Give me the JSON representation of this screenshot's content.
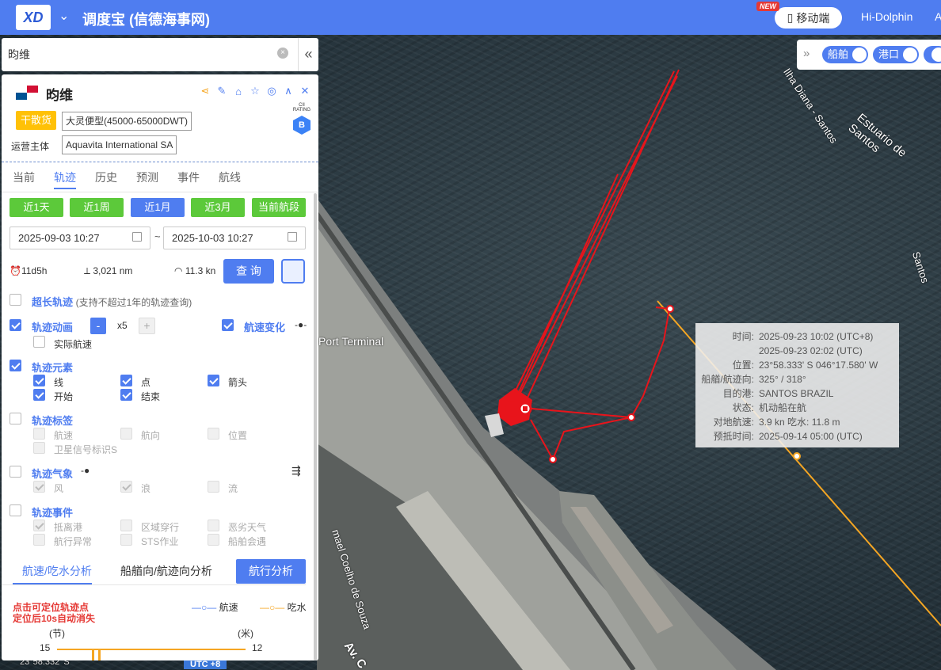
{
  "header": {
    "logo_text": "XD",
    "title": "调度宝 (信德海事网)",
    "new_badge": "NEW",
    "mobile_label": "移动端",
    "hi_dolphin": "Hi-Dolphin",
    "cut_text": "A"
  },
  "search": {
    "value": "昀维"
  },
  "ship": {
    "name": "昀维",
    "type_tag": "干散货",
    "size_tag": "大灵便型(45000-65000DWT)",
    "operator_label": "运营主体",
    "operator": "Aquavita International SA",
    "cii_label": "CII RATING",
    "cii": "B"
  },
  "tabs": [
    "当前",
    "轨迹",
    "历史",
    "预测",
    "事件",
    "航线"
  ],
  "range_buttons": [
    "近1天",
    "近1周",
    "近1月",
    "近3月",
    "当前航段"
  ],
  "dates": {
    "start": "2025-09-03 10:27",
    "end": "2025-10-03 10:27",
    "sep": "~"
  },
  "stats": {
    "duration": "11d5h",
    "distance": "3,021 nm",
    "speed": "11.3 kn"
  },
  "query_label": "查 询",
  "long_track": {
    "label": "超长轨迹",
    "note": "(支持不超过1年的轨迹查询)"
  },
  "animation": {
    "label": "轨迹动画",
    "minus": "-",
    "speed": "x5",
    "plus": "+",
    "actual_speed": "实际航速",
    "speed_change": "航速变化"
  },
  "elements": {
    "label": "轨迹元素",
    "items": [
      "线",
      "点",
      "箭头",
      "开始",
      "结束"
    ]
  },
  "labels": {
    "label": "轨迹标签",
    "items": [
      "航速",
      "航向",
      "位置",
      "卫星信号标识S"
    ]
  },
  "weather": {
    "label": "轨迹气象",
    "items": [
      "风",
      "浪",
      "流"
    ]
  },
  "events": {
    "label": "轨迹事件",
    "items": [
      "抵离港",
      "区域穿行",
      "恶劣天气",
      "航行异常",
      "STS作业",
      "船舶会遇"
    ]
  },
  "bottom_tabs": [
    "航速/吃水分析",
    "船艏向/航迹向分析",
    "航行分析"
  ],
  "chart_note": "点击可定位轨迹点\n定位后10s自动消失",
  "legend": {
    "speed": "航速",
    "draft": "吃水"
  },
  "axis": {
    "left_unit": "(节)",
    "right_unit": "(米)",
    "left_max": "15",
    "right_max": "12"
  },
  "tooltip": [
    {
      "k": "时间:",
      "v": "2025-09-23 10:02 (UTC+8)"
    },
    {
      "k": "",
      "v": "2025-09-23 02:02 (UTC)"
    },
    {
      "k": "位置:",
      "v": "23°58.333' S  046°17.580' W"
    },
    {
      "k": "船艏/航迹向:",
      "v": "325° / 318°"
    },
    {
      "k": "目的港:",
      "v": "SANTOS BRAZIL"
    },
    {
      "k": "状态:",
      "v": "机动船在航"
    },
    {
      "k": "对地航速:",
      "v": "3.9 kn  吃水: 11.8 m"
    },
    {
      "k": "预抵时间:",
      "v": "2025-09-14 05:00 (UTC)"
    }
  ],
  "map_controls": {
    "ships": "船舶",
    "ports": "港口"
  },
  "map_labels": {
    "terminal": "Port Terminal",
    "estuary": "Estuario de Santos",
    "ilha": "Ilha Diana - Santos",
    "santos": "Santos",
    "street": "mael Coelho de Souza",
    "av": "Av. C",
    "coord": "23°58.332' S",
    "utc": "UTC +8"
  },
  "colors": {
    "accent": "#4f7df0",
    "green": "#5cc93a",
    "track": "#e8141b",
    "route": "#f5a623"
  }
}
